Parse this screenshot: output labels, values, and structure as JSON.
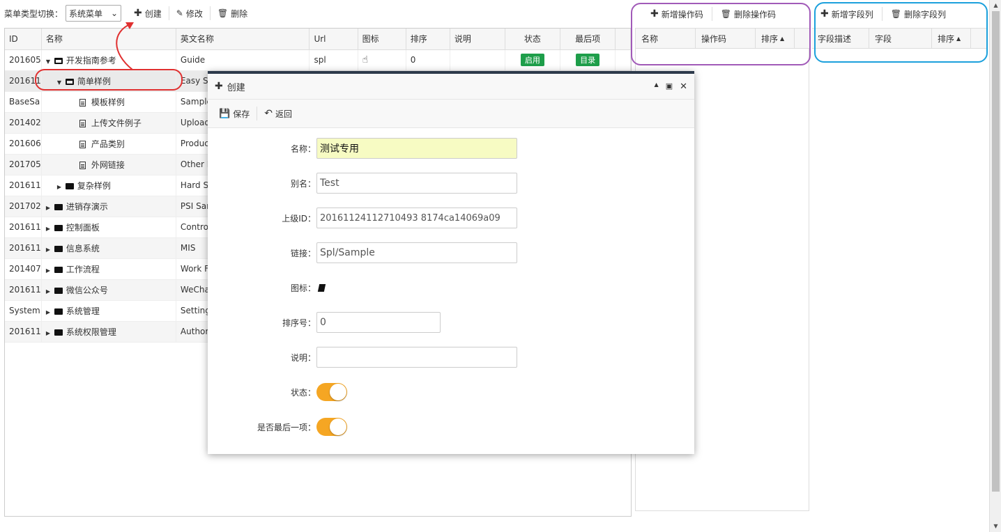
{
  "toolbar": {
    "menu_type_label": "菜单类型切换：",
    "menu_type_value": "系统菜单",
    "create": "创建",
    "edit": "修改",
    "delete": "删除"
  },
  "grid": {
    "columns": [
      "ID",
      "名称",
      "英文名称",
      "Url",
      "图标",
      "排序",
      "说明",
      "状态",
      "最后项"
    ],
    "rows": [
      {
        "id": "201605",
        "name": "开发指南参考",
        "en": "Guide",
        "url": "spl",
        "icon": "hand-pointer-icon",
        "sort": "0",
        "status": "启用",
        "last": "目录"
      },
      {
        "id": "201611",
        "name": "简单样例",
        "en": "Easy Sa"
      },
      {
        "id": "BaseSa",
        "name": "模板样例",
        "en": "Sample"
      },
      {
        "id": "201402",
        "name": "上传文件例子",
        "en": "Upload"
      },
      {
        "id": "201606",
        "name": "产品类别",
        "en": "Product"
      },
      {
        "id": "201705",
        "name": "外网链接",
        "en": "Other L"
      },
      {
        "id": "201611",
        "name": "复杂样例",
        "en": "Hard Sa"
      },
      {
        "id": "201702",
        "name": "进销存演示",
        "en": "PSI Sam"
      },
      {
        "id": "201611",
        "name": "控制面板",
        "en": "Control"
      },
      {
        "id": "201611",
        "name": "信息系统",
        "en": "MIS"
      },
      {
        "id": "201407",
        "name": "工作流程",
        "en": "Work Fl"
      },
      {
        "id": "201611",
        "name": "微信公众号",
        "en": "WeChat"
      },
      {
        "id": "System",
        "name": "系统管理",
        "en": "Setting"
      },
      {
        "id": "201611",
        "name": "系统权限管理",
        "en": "Authori"
      }
    ]
  },
  "opcode_panel": {
    "add": "新增操作码",
    "remove": "删除操作码",
    "columns": [
      "名称",
      "操作码",
      "排序"
    ]
  },
  "field_panel": {
    "add": "新增字段列",
    "remove": "删除字段列",
    "columns": [
      "字段描述",
      "字段",
      "排序"
    ]
  },
  "dialog": {
    "title": "创建",
    "save": "保存",
    "back": "返回",
    "fields": {
      "name_label": "名称：",
      "name_value": "测试专用",
      "alias_label": "别名：",
      "alias_value": "Test",
      "parent_label": "上级ID：",
      "parent_value": "20161124112710493 8174ca14069a09",
      "link_label": "链接：",
      "link_value": "Spl/Sample",
      "icon_label": "图标：",
      "sort_label": "排序号：",
      "sort_value": "0",
      "desc_label": "说明：",
      "desc_value": "",
      "status_label": "状态：",
      "last_label": "是否最后一项："
    }
  },
  "colors": {
    "badge_green": "#1e9e4a",
    "toggle_orange": "#f5a623",
    "focus_input": "#f7fbc3",
    "ring_red": "#e03030",
    "ring_purple": "#a15ab8",
    "ring_blue": "#1ba0dc"
  }
}
